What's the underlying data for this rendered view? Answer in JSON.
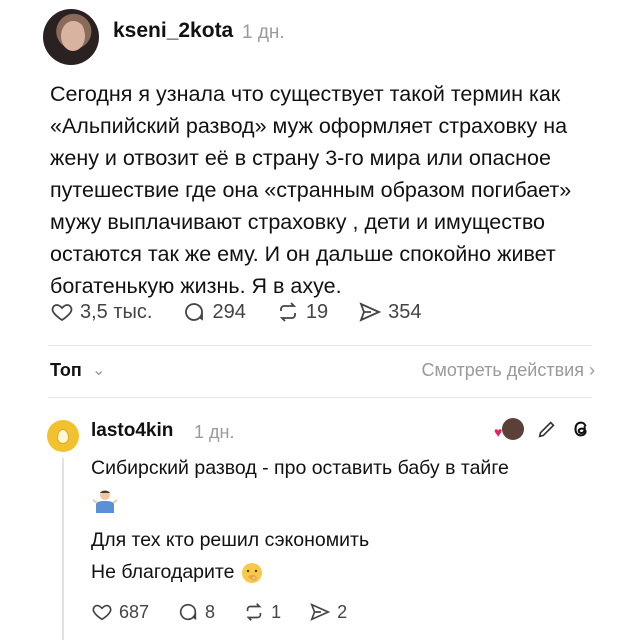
{
  "post": {
    "username": "kseni_2kota",
    "time": "1 дн.",
    "text": "Сегодня я узнала что существует такой термин как «Альпийский развод» муж оформляет страховку на жену и отвозит её в страну 3-го мира или опасное путешествие где она «странным образом погибает» мужу выплачивают страховку , дети и имущество остаются так же ему. И он дальше спокойно живет богатенькую жизнь. Я в ахуе.",
    "likes": "3,5 тыс.",
    "comments": "294",
    "reposts": "19",
    "shares": "354"
  },
  "sort": {
    "label": "Топ",
    "view_activity": "Смотреть действия"
  },
  "reply": {
    "username": "lasto4kin",
    "time": "1 дн.",
    "line1": "Сибирский развод - про оставить бабу в тайге",
    "line2": "Для тех кто решил сэкономить",
    "line3": "Не благодарите",
    "likes": "687",
    "comments": "8",
    "reposts": "1",
    "shares": "2"
  }
}
